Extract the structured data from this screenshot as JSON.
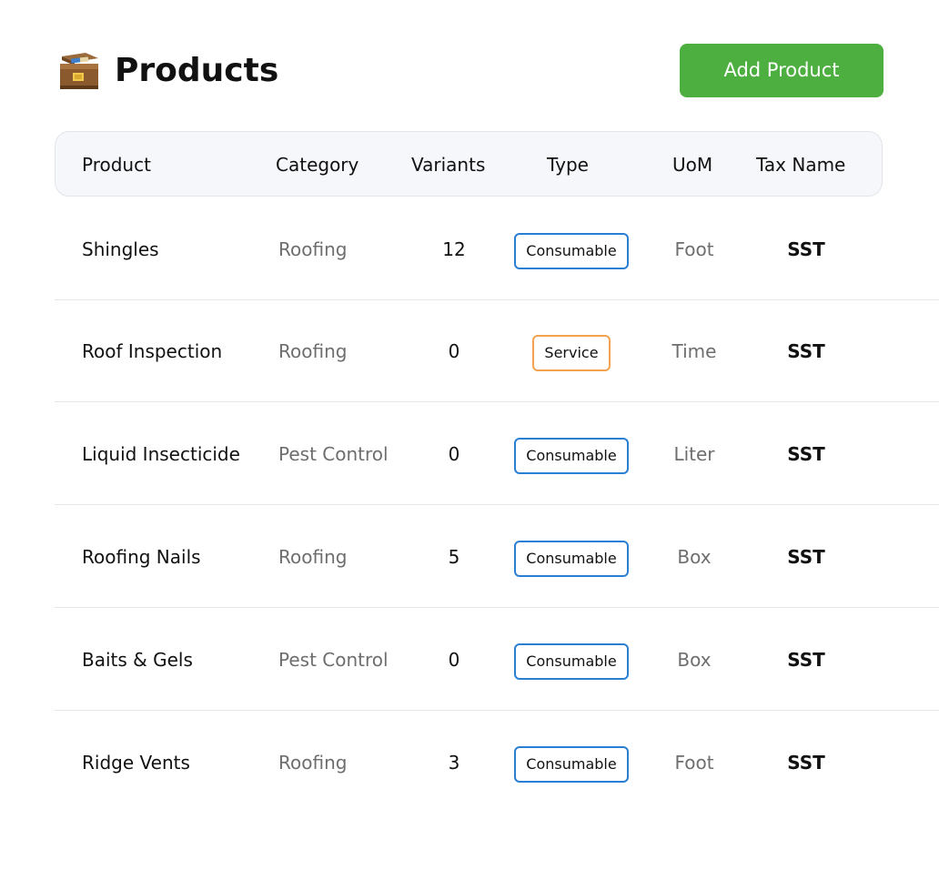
{
  "header": {
    "title": "Products",
    "icon": "open-box-icon",
    "add_button_label": "Add Product"
  },
  "table": {
    "columns": [
      "Product",
      "Category",
      "Variants",
      "Type",
      "UoM",
      "Tax Name"
    ],
    "rows": [
      {
        "product": "Shingles",
        "category": "Roofing",
        "variants": "12",
        "type": "Consumable",
        "uom": "Foot",
        "tax": "SST"
      },
      {
        "product": "Roof Inspection",
        "category": "Roofing",
        "variants": "0",
        "type": "Service",
        "uom": "Time",
        "tax": "SST"
      },
      {
        "product": "Liquid Insecticide",
        "category": "Pest Control",
        "variants": "0",
        "type": "Consumable",
        "uom": "Liter",
        "tax": "SST"
      },
      {
        "product": "Roofing Nails",
        "category": "Roofing",
        "variants": "5",
        "type": "Consumable",
        "uom": "Box",
        "tax": "SST"
      },
      {
        "product": "Baits & Gels",
        "category": "Pest Control",
        "variants": "0",
        "type": "Consumable",
        "uom": "Box",
        "tax": "SST"
      },
      {
        "product": "Ridge Vents",
        "category": "Roofing",
        "variants": "3",
        "type": "Consumable",
        "uom": "Foot",
        "tax": "SST"
      }
    ]
  },
  "colors": {
    "accent_green": "#4caf3f",
    "consumable_border": "#2a7fd4",
    "service_border": "#f4a24c"
  }
}
